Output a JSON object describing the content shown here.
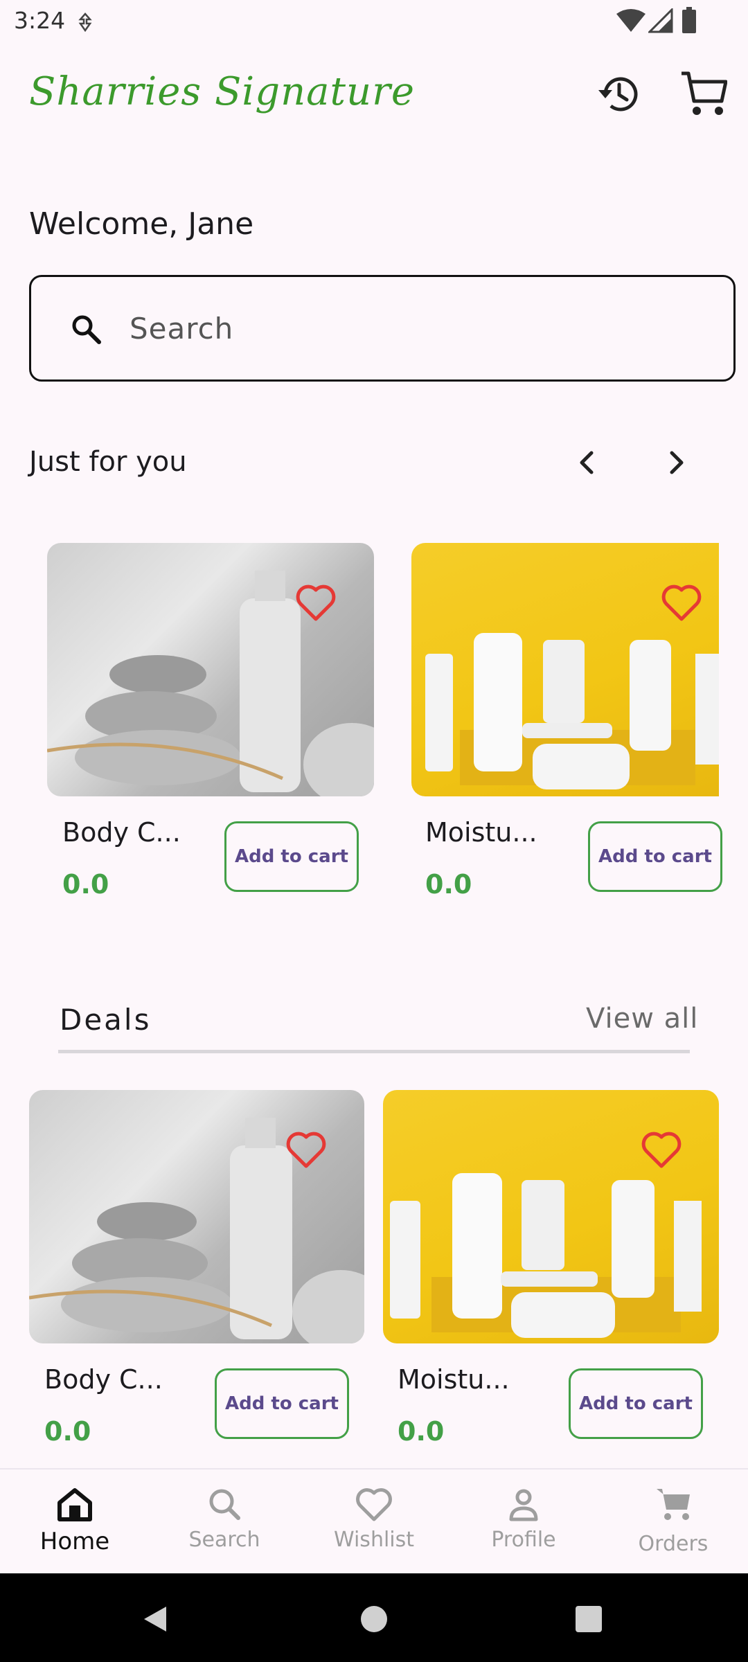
{
  "status_bar": {
    "time": "3:24"
  },
  "header": {
    "app_title": "Sharries Signature",
    "history_icon": "history-icon",
    "cart_icon": "cart-icon"
  },
  "welcome_text": "Welcome, Jane",
  "search": {
    "placeholder": "Search"
  },
  "just_for_you": {
    "title": "Just for you",
    "products": [
      {
        "name": "Body C...",
        "price": "0.0",
        "button": "Add to cart",
        "image": "grey stone and lotion bottle"
      },
      {
        "name": "Moistu...",
        "price": "0.0",
        "button": "Add to cart",
        "image": "white cosmetic products on yellow background"
      }
    ]
  },
  "deals": {
    "title": "Deals",
    "view_all": "View all",
    "products": [
      {
        "name": "Body C...",
        "price": "0.0",
        "button": "Add to cart",
        "image": "grey stone and lotion bottle"
      },
      {
        "name": "Moistu...",
        "price": "0.0",
        "button": "Add to cart",
        "image": "white cosmetic products on yellow background"
      }
    ]
  },
  "bottom_nav": {
    "items": [
      {
        "label": "Home",
        "icon": "home-icon",
        "active": true
      },
      {
        "label": "Search",
        "icon": "search-icon",
        "active": false
      },
      {
        "label": "Wishlist",
        "icon": "heart-icon",
        "active": false
      },
      {
        "label": "Profile",
        "icon": "person-icon",
        "active": false
      },
      {
        "label": "Orders",
        "icon": "cart-icon",
        "active": false
      }
    ]
  },
  "colors": {
    "brand_green": "#3c9a2c",
    "price_green": "#43a047",
    "heart_red": "#e53935",
    "button_text": "#5b4a8c",
    "background": "#fdf7fb"
  }
}
